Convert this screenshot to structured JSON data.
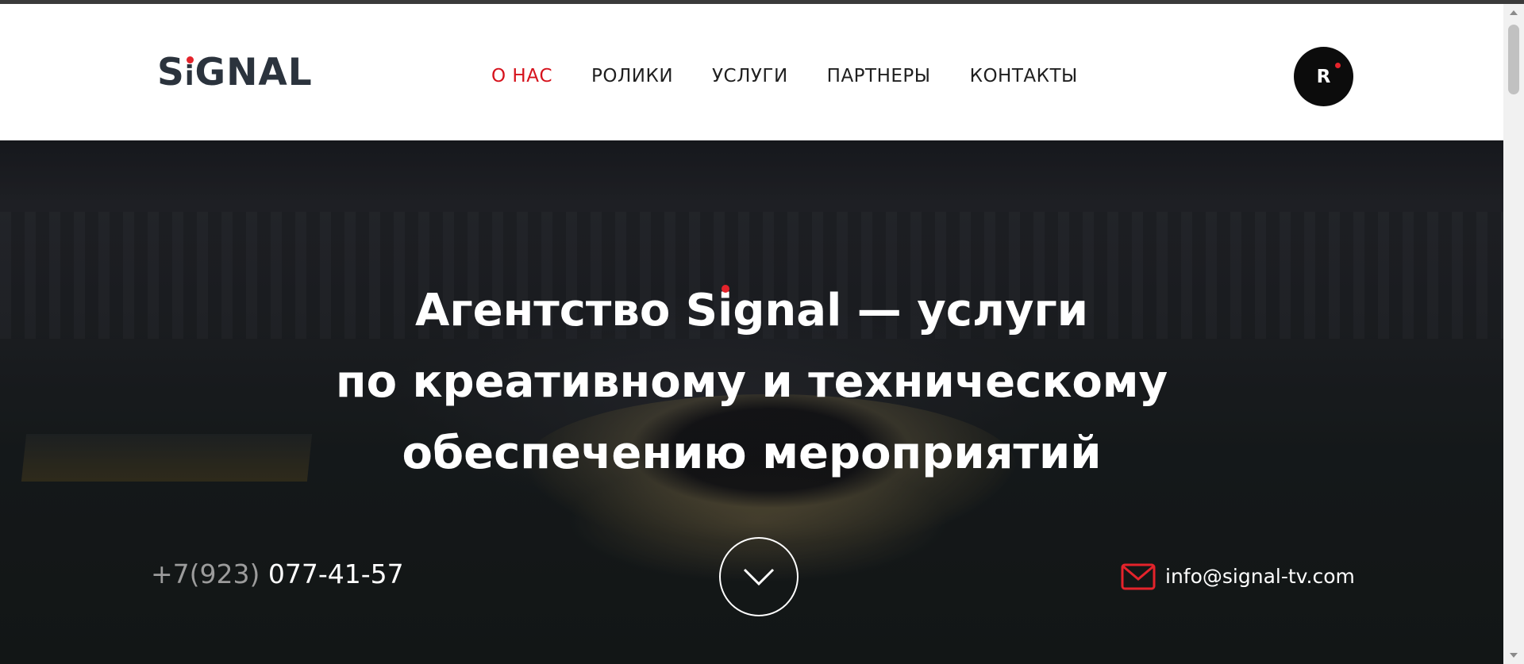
{
  "colors": {
    "accent": "#d6121c",
    "logo_dark": "#2b333d",
    "badge_bg": "#0c0c0c"
  },
  "header": {
    "logo_text": {
      "s": "S",
      "i": "i",
      "rest": "GNAL"
    },
    "nav": [
      {
        "label": "О НАС",
        "active": true
      },
      {
        "label": "РОЛИКИ",
        "active": false
      },
      {
        "label": "УСЛУГИ",
        "active": false
      },
      {
        "label": "ПАРТНЕРЫ",
        "active": false
      },
      {
        "label": "КОНТАКТЫ",
        "active": false
      }
    ],
    "badge_letter": "R"
  },
  "hero": {
    "headline": {
      "line1_before": "Агентство ",
      "line1_brand_s": "S",
      "line1_brand_rest": "ignal",
      "line1_after": " — услуги",
      "line2": "по креативному и техническому",
      "line3": "обеспечению мероприятий"
    },
    "phone": {
      "prefix": "+7(923)",
      "number": "077-41-57"
    },
    "scroll_icon": "chevron-down-icon",
    "email": {
      "icon": "mail-icon",
      "address": "info@signal-tv.com"
    }
  }
}
